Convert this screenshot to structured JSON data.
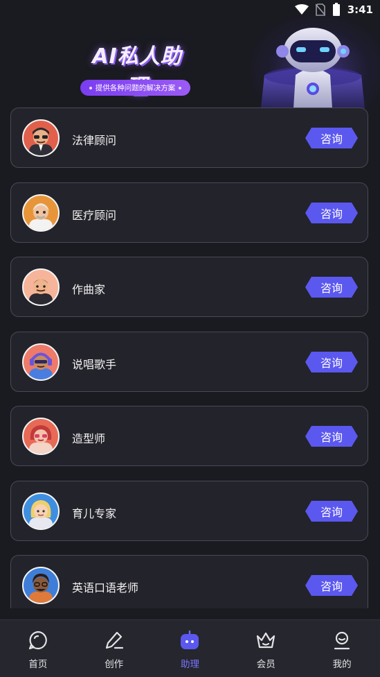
{
  "status_bar": {
    "time": "3:41",
    "icons": [
      "wifi-icon",
      "no-sim-icon",
      "battery-icon"
    ]
  },
  "header": {
    "title": "AI私人助理",
    "subtitle": "提供各种问题的解决方案"
  },
  "assistants": [
    {
      "name": "法律顾问",
      "button": "咨询",
      "avatar": "lawyer-avatar",
      "color": "#e0604c"
    },
    {
      "name": "医疗顾问",
      "button": "咨询",
      "avatar": "doctor-avatar",
      "color": "#e8953a"
    },
    {
      "name": "作曲家",
      "button": "咨询",
      "avatar": "composer-avatar",
      "color": "#f08a6c"
    },
    {
      "name": "说唱歌手",
      "button": "咨询",
      "avatar": "rapper-avatar",
      "color": "#ee7a6a"
    },
    {
      "name": "造型师",
      "button": "咨询",
      "avatar": "stylist-avatar",
      "color": "#e76a56"
    },
    {
      "name": "育儿专家",
      "button": "咨询",
      "avatar": "parenting-avatar",
      "color": "#3f8fe0"
    },
    {
      "name": "英语口语老师",
      "button": "咨询",
      "avatar": "english-teacher-avatar",
      "color": "#3f7ed8"
    }
  ],
  "bottom_nav": {
    "active": "助理",
    "items": [
      {
        "label": "首页",
        "icon": "home-chat-icon"
      },
      {
        "label": "创作",
        "icon": "pen-icon"
      },
      {
        "label": "助理",
        "icon": "assistant-robot-icon"
      },
      {
        "label": "会员",
        "icon": "crown-icon"
      },
      {
        "label": "我的",
        "icon": "profile-icon"
      }
    ]
  },
  "colors": {
    "accent": "#5b58f0",
    "active_nav": "#7a74ff",
    "pill": "#8a4cf3",
    "card_bg": "#23232b"
  }
}
